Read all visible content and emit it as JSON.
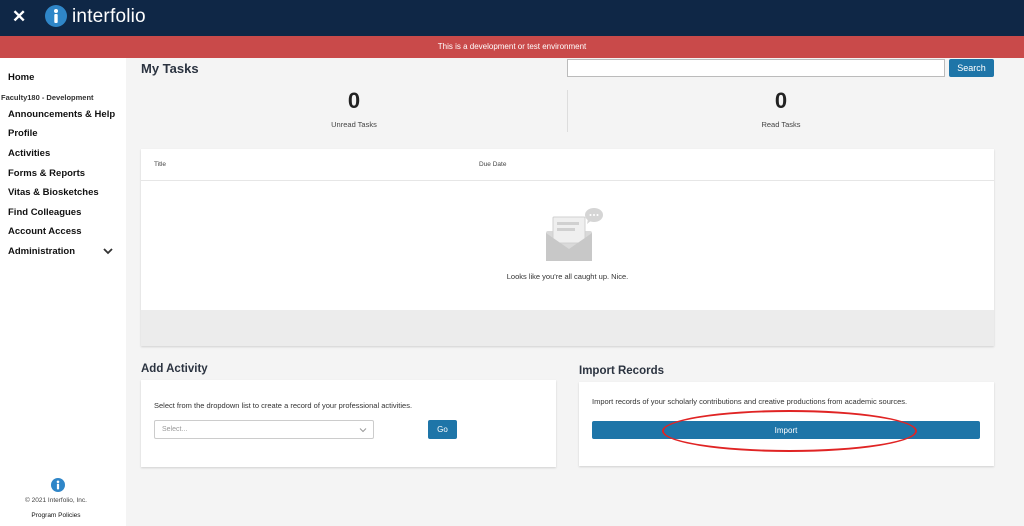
{
  "header": {
    "close_icon": "close-icon",
    "logo_icon": "interfolio-logo-icon",
    "logo_text": "interfolio"
  },
  "env_banner": "This is a development or test environment",
  "sidebar": {
    "home": "Home",
    "institution": "Faculty180 - Development",
    "items": [
      "Announcements & Help",
      "Profile",
      "Activities",
      "Forms & Reports",
      "Vitas & Biosketches",
      "Find Colleagues",
      "Account Access",
      "Administration"
    ],
    "copyright": "© 2021 Interfolio, Inc.",
    "policies": "Program Policies"
  },
  "tasks": {
    "title": "My Tasks",
    "search_placeholder": "",
    "search_button": "Search",
    "unread_count": "0",
    "unread_label": "Unread Tasks",
    "read_count": "0",
    "read_label": "Read Tasks",
    "columns": [
      "Title",
      "Due Date"
    ],
    "empty_message": "Looks like you're all caught up. Nice."
  },
  "add_activity": {
    "title": "Add Activity",
    "description": "Select from the dropdown list to create a record of your professional activities.",
    "select_placeholder": "Select...",
    "go_button": "Go"
  },
  "import_records": {
    "title": "Import Records",
    "description": "Import records of your scholarly contributions and creative productions from academic sources.",
    "import_button": "Import"
  },
  "colors": {
    "topbar": "#0f2746",
    "banner": "#c94a4a",
    "primary_button": "#1e75a8",
    "highlight": "#e02424"
  }
}
